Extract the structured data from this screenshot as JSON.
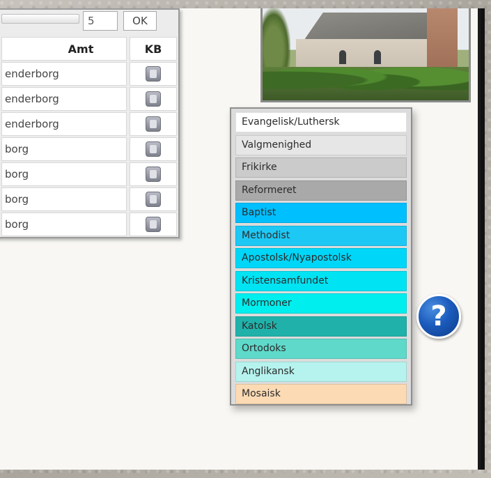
{
  "pager": {
    "page_value": "5",
    "ok_label": "OK"
  },
  "table": {
    "columns": [
      "Amt",
      "KB"
    ],
    "rows": [
      {
        "amt": "enderborg",
        "kb_icon": "book-icon"
      },
      {
        "amt": "enderborg",
        "kb_icon": "book-icon"
      },
      {
        "amt": "enderborg",
        "kb_icon": "book-icon"
      },
      {
        "amt": "borg",
        "kb_icon": "book-icon"
      },
      {
        "amt": "borg",
        "kb_icon": "book-icon"
      },
      {
        "amt": "borg",
        "kb_icon": "book-icon"
      },
      {
        "amt": "borg",
        "kb_icon": "book-icon"
      }
    ]
  },
  "legend": {
    "items": [
      {
        "label": "Evangelisk/Luthersk",
        "color": "#ffffff"
      },
      {
        "label": "Valgmenighed",
        "color": "#e6e6e6"
      },
      {
        "label": "Frikirke",
        "color": "#cbcbcb"
      },
      {
        "label": "Reformeret",
        "color": "#a9a9a9"
      },
      {
        "label": "Baptist",
        "color": "#00bfff"
      },
      {
        "label": "Methodist",
        "color": "#1ec8f5"
      },
      {
        "label": "Apostolsk/Nyapostolsk",
        "color": "#00d6f8"
      },
      {
        "label": "Kristensamfundet",
        "color": "#00e3f3"
      },
      {
        "label": "Mormoner",
        "color": "#00eeee"
      },
      {
        "label": "Katolsk",
        "color": "#20b2aa"
      },
      {
        "label": "Ortodoks",
        "color": "#5fd9ca"
      },
      {
        "label": "Anglikansk",
        "color": "#b6f3ee"
      },
      {
        "label": "Mosaisk",
        "color": "#fcdbb4"
      }
    ]
  },
  "help": {
    "label": "?",
    "icon": "help-icon",
    "color": "#1b5bbd"
  },
  "photo": {
    "subject": "church-photo"
  }
}
